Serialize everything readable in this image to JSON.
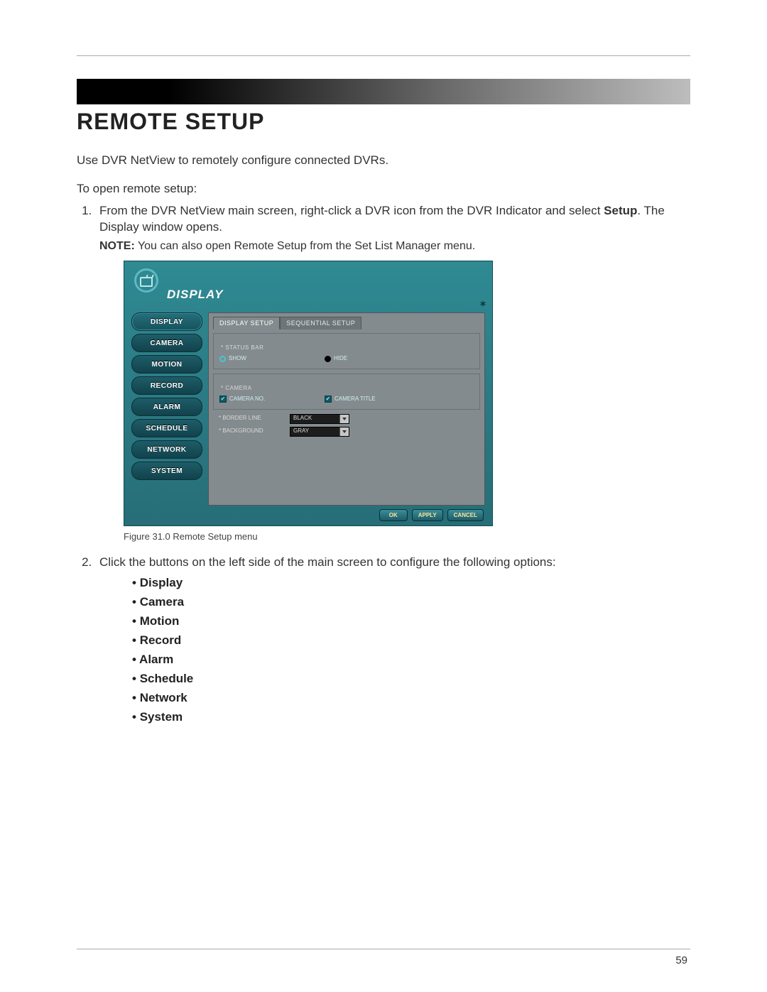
{
  "page": {
    "heading": "REMOTE SETUP",
    "intro": "Use DVR NetView to remotely configure connected DVRs.",
    "subintro": "To open remote setup:",
    "step1_a": "From the DVR NetView main screen, right-click a DVR icon from the DVR Indicator and select ",
    "step1_bold": "Setup",
    "step1_b": ". The Display window opens.",
    "note_label": "NOTE:",
    "note_text": " You can also open Remote Setup from the Set List Manager menu.",
    "step2": "Click the buttons on the left side of the main screen to configure the following options:",
    "fig_caption": "Figure 31.0 Remote Setup menu",
    "page_number": "59"
  },
  "app": {
    "title": "DISPLAY",
    "close_glyph": "✶",
    "side_buttons": [
      "DISPLAY",
      "CAMERA",
      "MOTION",
      "RECORD",
      "ALARM",
      "SCHEDULE",
      "NETWORK",
      "SYSTEM"
    ],
    "tabs": [
      "DISPLAY SETUP",
      "SEQUENTIAL SETUP"
    ],
    "group_statusbar": {
      "label": "* STATUS BAR",
      "opt_show": "SHOW",
      "opt_hide": "HIDE"
    },
    "group_camera": {
      "label": "* CAMERA",
      "opt_no": "CAMERA NO.",
      "opt_title": "CAMERA TITLE"
    },
    "kv_border": {
      "label": "* BORDER LINE",
      "value": "BLACK"
    },
    "kv_background": {
      "label": "* BACKGROUND",
      "value": "GRAY"
    },
    "footer": {
      "ok": "OK",
      "apply": "APPLY",
      "cancel": "CANCEL"
    }
  },
  "options": [
    "Display",
    "Camera",
    "Motion",
    "Record",
    "Alarm",
    "Schedule",
    "Network",
    "System"
  ]
}
